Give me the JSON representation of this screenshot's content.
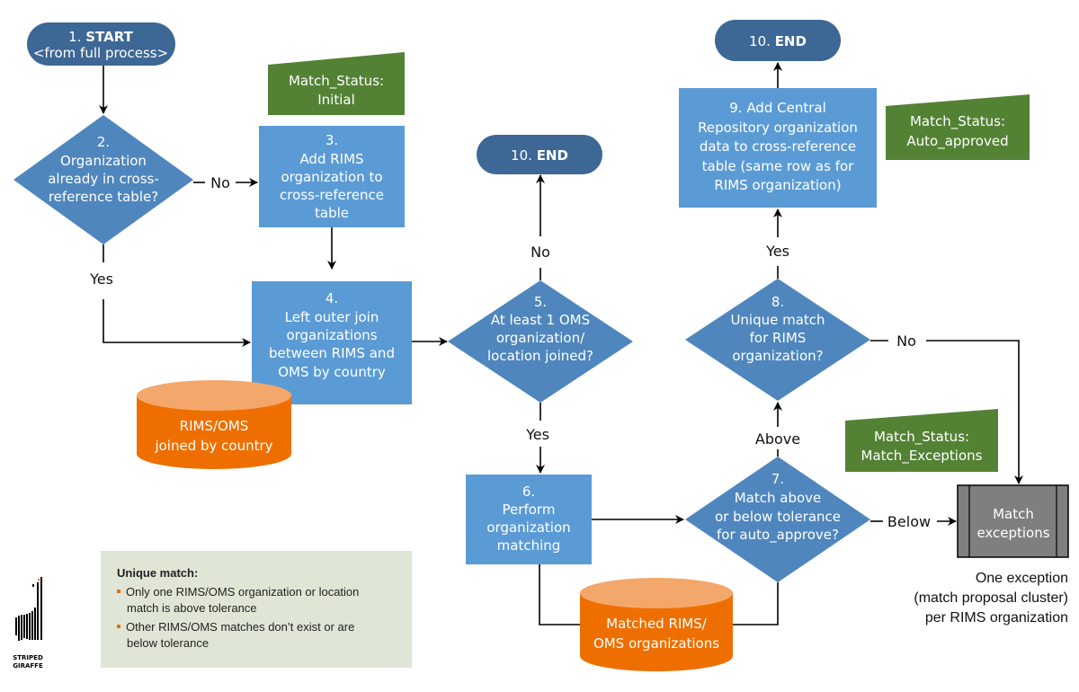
{
  "colors": {
    "terminal": "#3d6794",
    "process": "#5b9bd5",
    "decision": "#4f86bd",
    "status_tag": "#548235",
    "datastore": "#ee6f00",
    "datastore_top": "#f4a76a",
    "exception": "#7f7f7f",
    "note_bg": "#dfe6d6",
    "bullet": "#ee6f00"
  },
  "nodes": {
    "start": {
      "num": "1.",
      "bold": "START",
      "sub": "<from full process>"
    },
    "d2": {
      "lines": [
        "2.",
        "Organization",
        "already in cross-",
        "reference table?"
      ]
    },
    "p3": {
      "lines": [
        "3.",
        "Add RIMS",
        "organization to",
        "cross-reference",
        "table"
      ]
    },
    "p4": {
      "lines": [
        "4.",
        "Left outer join",
        "organizations",
        "between RIMS and",
        "OMS by country"
      ]
    },
    "d5": {
      "lines": [
        "5.",
        "At least 1 OMS",
        "organization/",
        "location joined?"
      ]
    },
    "end_mid": {
      "num": "10.",
      "bold": "END"
    },
    "p6": {
      "lines": [
        "6.",
        "Perform",
        "organization",
        "matching"
      ]
    },
    "d7": {
      "lines": [
        "7.",
        "Match above",
        "or below tolerance",
        "for auto_approve?"
      ]
    },
    "d8": {
      "lines": [
        "8.",
        "Unique match",
        "for RIMS",
        "organization?"
      ]
    },
    "p9": {
      "lines": [
        "9. Add Central",
        "Repository organization",
        "data to cross-reference",
        "table (same row as for",
        "RIMS organization)"
      ]
    },
    "end_top": {
      "num": "10.",
      "bold": "END"
    },
    "exceptions": {
      "lines": [
        "Match",
        "exceptions"
      ]
    }
  },
  "datastores": {
    "joined": {
      "lines": [
        "RIMS/OMS",
        "joined by country"
      ]
    },
    "matched": {
      "lines": [
        "Matched RIMS/",
        "OMS organizations"
      ]
    }
  },
  "status_tags": {
    "initial": {
      "lines": [
        "Match_Status:",
        "Initial"
      ]
    },
    "auto": {
      "lines": [
        "Match_Status:",
        "Auto_approved"
      ]
    },
    "exceptions": {
      "lines": [
        "Match_Status:",
        "Match_Exceptions"
      ]
    }
  },
  "edge_labels": {
    "d2_no": "No",
    "d2_yes": "Yes",
    "d5_no": "No",
    "d5_yes": "Yes",
    "d7_below": "Below",
    "d7_above": "Above",
    "d8_yes": "Yes",
    "d8_no": "No"
  },
  "caption": {
    "lines": [
      "One exception",
      "(match proposal cluster)",
      "per RIMS organization"
    ]
  },
  "note": {
    "title": "Unique match:",
    "bullets": [
      [
        "Only one RIMS/OMS organization or location",
        "match is above tolerance"
      ],
      [
        "Other RIMS/OMS matches don’t exist or are",
        "below tolerance"
      ]
    ]
  },
  "logo": {
    "line1": "STRIPED",
    "line2": "GIRAFFE"
  }
}
